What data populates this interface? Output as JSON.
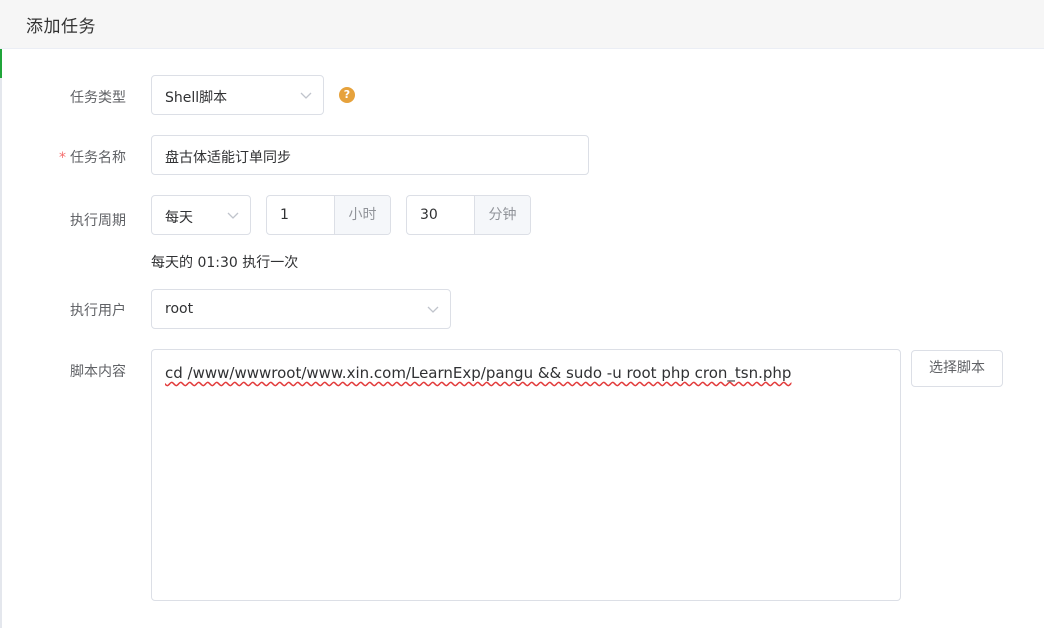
{
  "dialog": {
    "title": "添加任务"
  },
  "form": {
    "task_type": {
      "label": "任务类型",
      "value": "Shell脚本",
      "help_icon": "question-circle-icon",
      "help_glyph": "?"
    },
    "task_name": {
      "label": "任务名称",
      "required_mark": "*",
      "value": "盘古体适能订单同步"
    },
    "cycle": {
      "label": "执行周期",
      "period": "每天",
      "hour": "1",
      "hour_unit": "小时",
      "minute": "30",
      "minute_unit": "分钟",
      "hint": "每天的 01:30 执行一次"
    },
    "user": {
      "label": "执行用户",
      "value": "root"
    },
    "script": {
      "label": "脚本内容",
      "content": "cd /www/wwwroot/www.xin.com/LearnExp/pangu && sudo -u root php cron_tsn.php",
      "select_button": "选择脚本"
    }
  },
  "colors": {
    "accent": "#20a53a",
    "help": "#e6a23c",
    "required": "#f56c6c",
    "spellcheck": "#e23b3b"
  }
}
